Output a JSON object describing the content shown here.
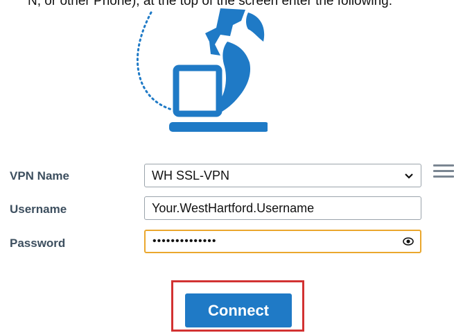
{
  "intro_text": "N, or other Phone), at the top of the screen enter the following:",
  "hero": {
    "icon": "globe-laptop-illustration"
  },
  "form": {
    "vpn_name_label": "VPN Name",
    "vpn_name_value": "WH SSL-VPN",
    "username_label": "Username",
    "username_value": "Your.WestHartford.Username",
    "password_label": "Password",
    "password_value": "••••••••••••••",
    "connect_label": "Connect"
  },
  "colors": {
    "brand_blue": "#1f7ac6",
    "focus_orange": "#eaa72d",
    "highlight_red": "#d23232"
  }
}
